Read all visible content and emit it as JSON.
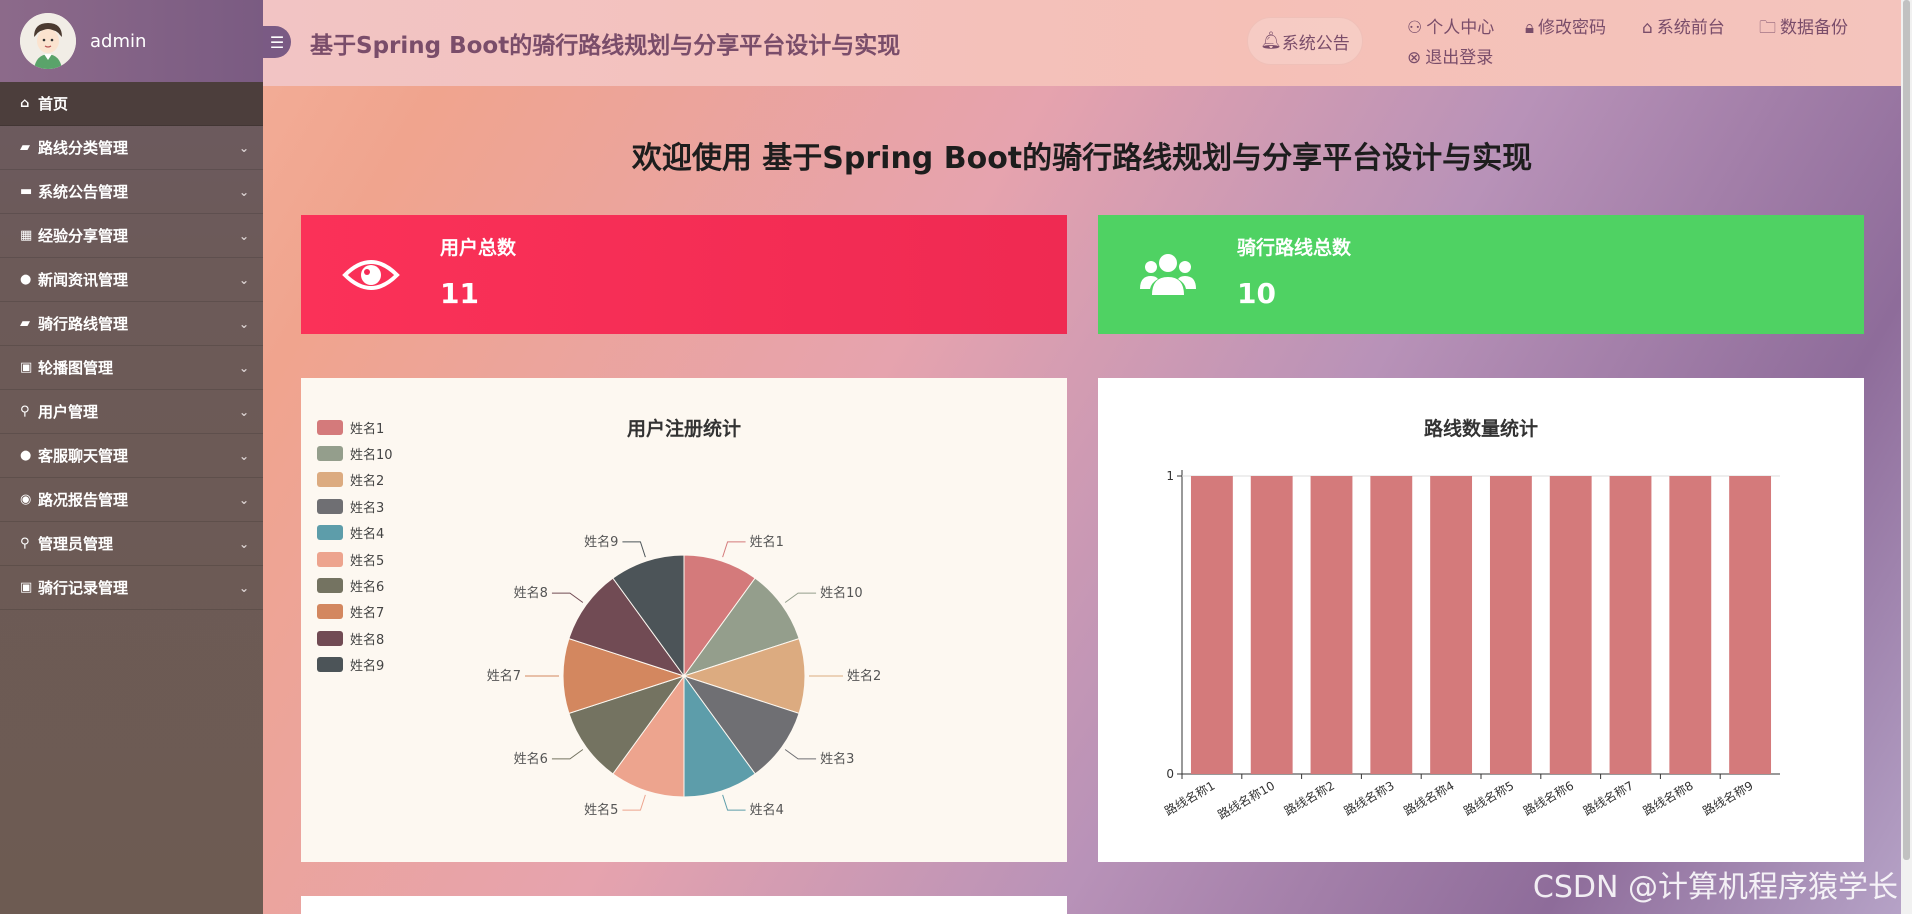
{
  "user": {
    "name": "admin"
  },
  "header": {
    "title": "基于Spring Boot的骑行路线规划与分享平台设计与实现",
    "notice": "系统公告",
    "links": [
      "个人中心",
      "修改密码",
      "系统前台",
      "数据备份",
      "退出登录"
    ]
  },
  "sidebar": {
    "items": [
      {
        "label": "首页",
        "icon": "home-icon"
      },
      {
        "label": "路线分类管理",
        "icon": "folder-icon"
      },
      {
        "label": "系统公告管理",
        "icon": "card-icon"
      },
      {
        "label": "经验分享管理",
        "icon": "grid-icon"
      },
      {
        "label": "新闻资讯管理",
        "icon": "drop-icon"
      },
      {
        "label": "骑行路线管理",
        "icon": "folder-icon"
      },
      {
        "label": "轮播图管理",
        "icon": "save-icon"
      },
      {
        "label": "用户管理",
        "icon": "user-icon"
      },
      {
        "label": "客服聊天管理",
        "icon": "circle-icon"
      },
      {
        "label": "路况报告管理",
        "icon": "target-icon"
      },
      {
        "label": "管理员管理",
        "icon": "user-icon"
      },
      {
        "label": "骑行记录管理",
        "icon": "save-icon"
      }
    ]
  },
  "main": {
    "welcome": "欢迎使用 基于Spring Boot的骑行路线规划与分享平台设计与实现",
    "stats": [
      {
        "label": "用户总数",
        "value": "11",
        "icon": "eye-icon",
        "color": "#f52a55"
      },
      {
        "label": "骑行路线总数",
        "value": "10",
        "icon": "users-icon",
        "color": "#4fd263"
      }
    ]
  },
  "chart_data": [
    {
      "type": "pie",
      "title": "用户注册统计",
      "categories": [
        "姓名1",
        "姓名10",
        "姓名2",
        "姓名3",
        "姓名4",
        "姓名5",
        "姓名6",
        "姓名7",
        "姓名8",
        "姓名9"
      ],
      "values": [
        1,
        1,
        1,
        1,
        1,
        1,
        1,
        1,
        1,
        1
      ],
      "colors": [
        "#d47a7b",
        "#949e8c",
        "#dcab80",
        "#6f6f73",
        "#5d9daa",
        "#eda48e",
        "#747361",
        "#d3875f",
        "#714b54",
        "#4c5458"
      ],
      "legend": "left"
    },
    {
      "type": "bar",
      "title": "路线数量统计",
      "categories": [
        "路线名称1",
        "路线名称10",
        "路线名称2",
        "路线名称3",
        "路线名称4",
        "路线名称5",
        "路线名称6",
        "路线名称7",
        "路线名称8",
        "路线名称9"
      ],
      "values": [
        1,
        1,
        1,
        1,
        1,
        1,
        1,
        1,
        1,
        1
      ],
      "ylim": [
        0,
        1
      ],
      "yticks": [
        "0",
        "1"
      ],
      "color": "#d47a7b"
    }
  ],
  "watermark": "CSDN @计算机程序猿学长"
}
